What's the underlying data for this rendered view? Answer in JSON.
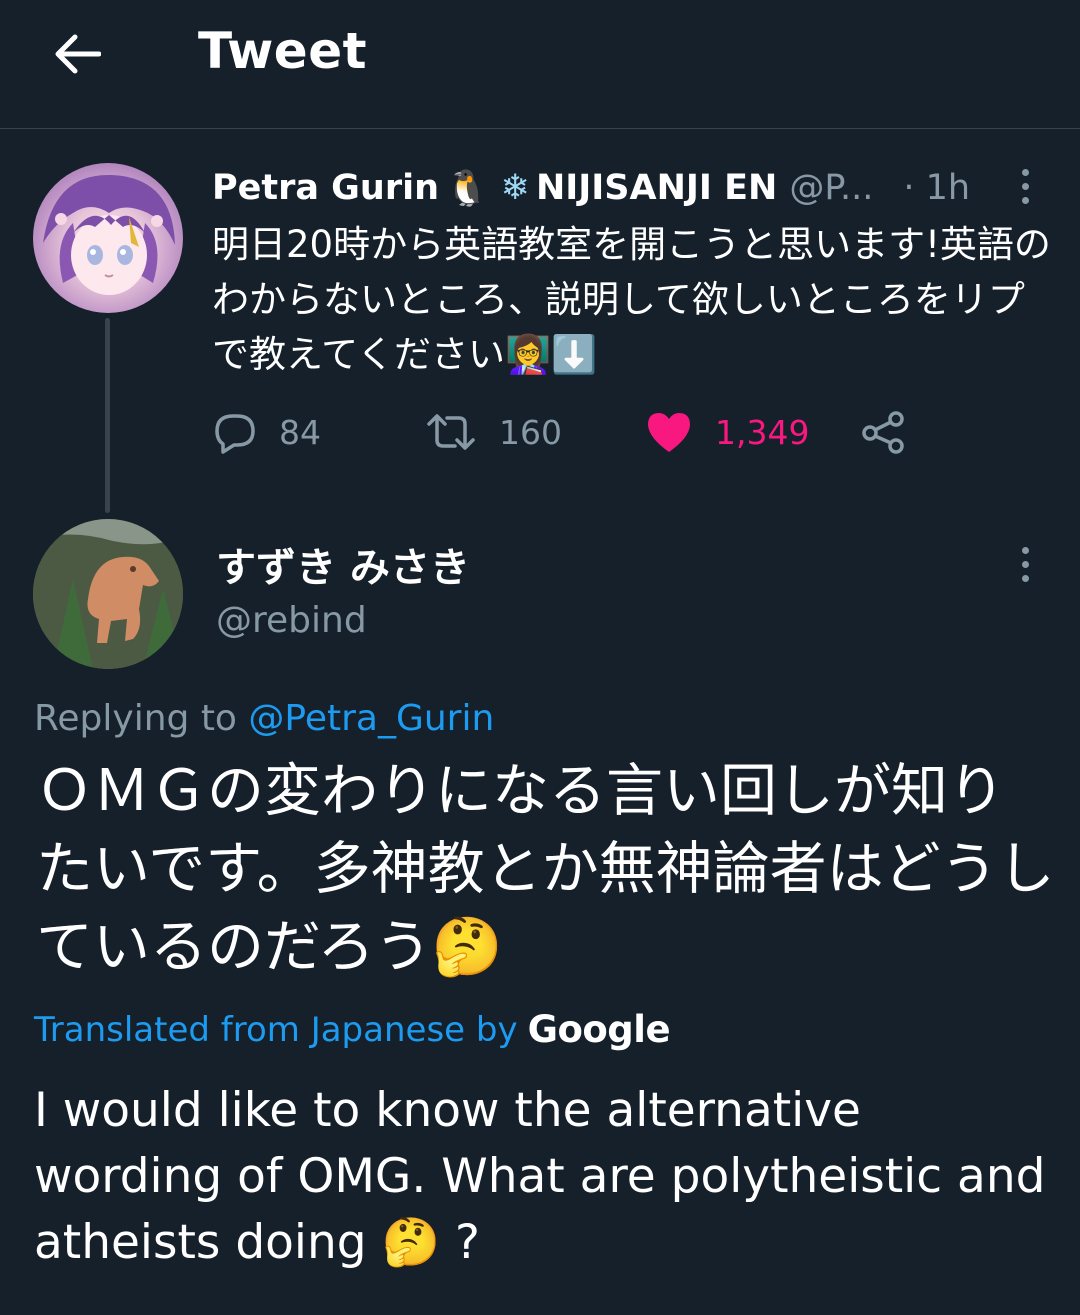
{
  "header": {
    "title": "Tweet",
    "back_icon": "arrow-left-icon"
  },
  "parent_tweet": {
    "display_name": "Petra Gurin",
    "name_emoji_1": "🐧",
    "name_emoji_2": "❄",
    "name_suffix": "NIJISANJI EN",
    "handle_truncated": "@P...",
    "timestamp": "· 1h",
    "text": "明日20時から英語教室を開こうと思います!英語のわからないところ、説明して欲しいところをリプで教えてください👩‍🏫⬇️",
    "stats": {
      "replies": "84",
      "retweets": "160",
      "likes": "1,349"
    },
    "like_color": "#f91880"
  },
  "reply_tweet": {
    "display_name": "すずき みさき",
    "handle": "@rebind",
    "replying_to_label": "Replying to",
    "replying_to_handle": "@Petra_Gurin",
    "text": "ＯＭＧの変わりになる言い回しが知りたいです。多神教とか無神論者はどうしているのだろう🤔",
    "translated_label": "Translated from Japanese by",
    "translator": "Google",
    "translation": "I would like to know the alternative wording of OMG. What are polytheistic and atheists doing 🤔 ?"
  },
  "colors": {
    "background": "#15202b",
    "link": "#1d9bf0",
    "muted": "#8899a6"
  }
}
